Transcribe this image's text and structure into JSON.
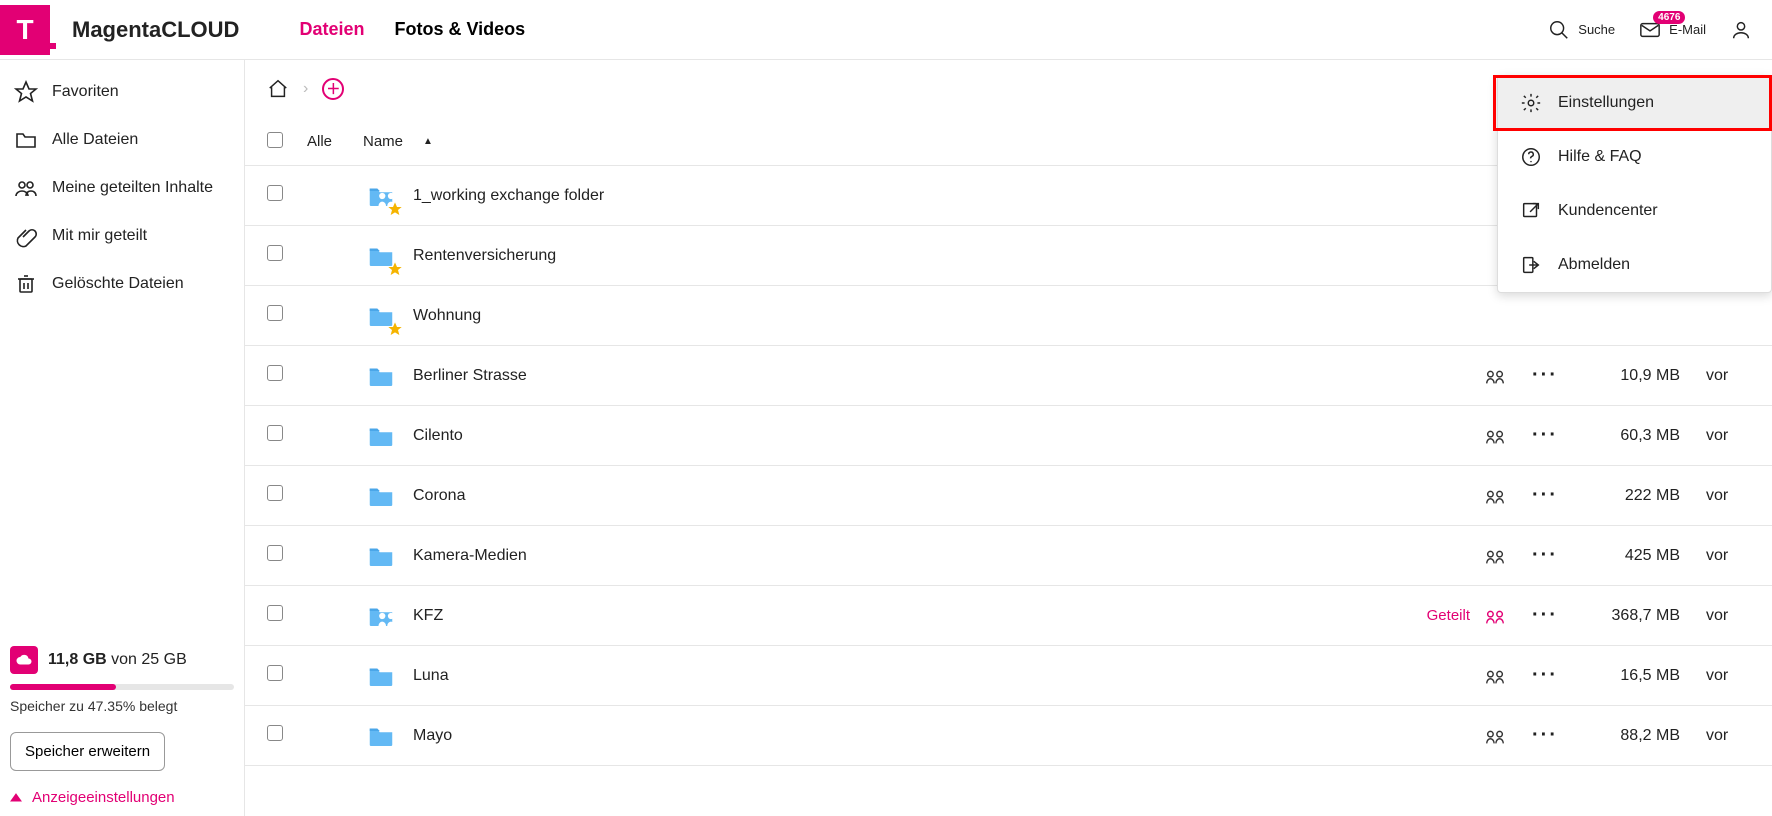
{
  "header": {
    "brand": "MagentaCLOUD",
    "nav": {
      "files": "Dateien",
      "media": "Fotos & Videos"
    },
    "search_label": "Suche",
    "mail_label": "E-Mail",
    "mail_badge": "4676"
  },
  "sidebar": {
    "items": [
      {
        "id": "favorites",
        "label": "Favoriten",
        "icon": "star"
      },
      {
        "id": "all",
        "label": "Alle Dateien",
        "icon": "folder"
      },
      {
        "id": "myshared",
        "label": "Meine geteilten Inhalte",
        "icon": "people"
      },
      {
        "id": "shared",
        "label": "Mit mir geteilt",
        "icon": "clip"
      },
      {
        "id": "trash",
        "label": "Gelöschte Dateien",
        "icon": "trash"
      }
    ],
    "storage": {
      "used": "11,8 GB",
      "of_label": "von",
      "total": "25 GB",
      "note": "Speicher zu 47.35% belegt",
      "expand_btn": "Speicher erweitern",
      "display_settings": "Anzeigeeinstellungen"
    }
  },
  "table": {
    "all_label": "Alle",
    "name_label": "Name",
    "shared_word": "Geteilt",
    "time_word": "vor",
    "rows": [
      {
        "name": "1_working exchange folder",
        "fav": true,
        "shared_folder": true,
        "size": "",
        "has_meta": false
      },
      {
        "name": "Rentenversicherung",
        "fav": true,
        "shared_folder": false,
        "size": "",
        "has_meta": false
      },
      {
        "name": "Wohnung",
        "fav": true,
        "shared_folder": false,
        "size": "",
        "has_meta": false
      },
      {
        "name": "Berliner Strasse",
        "fav": false,
        "shared_folder": false,
        "size": "10,9 MB",
        "has_meta": true
      },
      {
        "name": "Cilento",
        "fav": false,
        "shared_folder": false,
        "size": "60,3 MB",
        "has_meta": true
      },
      {
        "name": "Corona",
        "fav": false,
        "shared_folder": false,
        "size": "222 MB",
        "has_meta": true
      },
      {
        "name": "Kamera-Medien",
        "fav": false,
        "shared_folder": false,
        "size": "425 MB",
        "has_meta": true
      },
      {
        "name": "KFZ",
        "fav": false,
        "shared_folder": true,
        "size": "368,7 MB",
        "has_meta": true,
        "is_shared": true
      },
      {
        "name": "Luna",
        "fav": false,
        "shared_folder": false,
        "size": "16,5 MB",
        "has_meta": true
      },
      {
        "name": "Mayo",
        "fav": false,
        "shared_folder": false,
        "size": "88,2 MB",
        "has_meta": true
      }
    ]
  },
  "menu": {
    "settings": "Einstellungen",
    "help": "Hilfe & FAQ",
    "kc": "Kundencenter",
    "logout": "Abmelden"
  }
}
